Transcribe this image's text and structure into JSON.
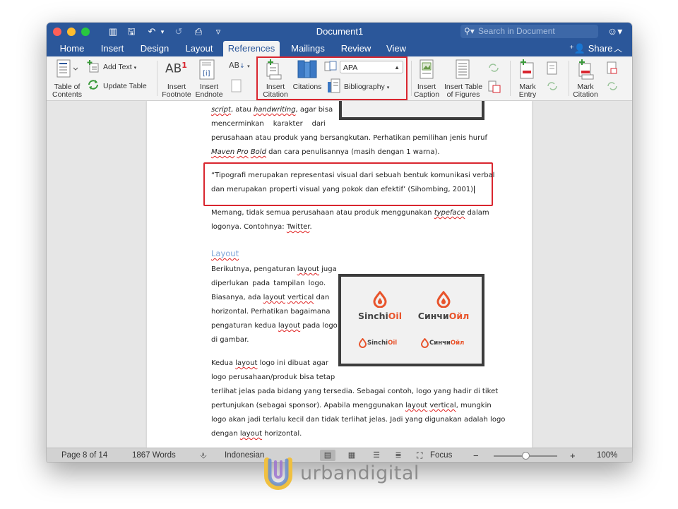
{
  "window": {
    "title": "Document1",
    "search_placeholder": "Search in Document",
    "qat": {
      "layout_icon": "▥",
      "save_icon": "🖫",
      "undo_icon": "↶",
      "undo_menu": "▾",
      "redo_icon": "↺",
      "print_icon": "⎙",
      "customize_icon": "▿"
    },
    "user_icon": "☺▾"
  },
  "tabs": [
    {
      "label": "Home"
    },
    {
      "label": "Insert"
    },
    {
      "label": "Design"
    },
    {
      "label": "Layout"
    },
    {
      "label": "References",
      "active": true
    },
    {
      "label": "Mailings"
    },
    {
      "label": "Review"
    },
    {
      "label": "View"
    }
  ],
  "share_label": "Share",
  "share_icon": "⁺👤",
  "collapse_icon": "︿",
  "ribbon": {
    "toc": {
      "line1": "Table of",
      "line2": "Contents"
    },
    "add_text": "Add Text",
    "update_table": "Update Table",
    "insert_footnote": {
      "line1": "Insert",
      "line2": "Footnote"
    },
    "insert_endnote": {
      "line1": "Insert",
      "line2": "Endnote"
    },
    "insert_citation": {
      "line1": "Insert",
      "line2": "Citation"
    },
    "citations": "Citations",
    "style_select": "APA",
    "bibliography": "Bibliography",
    "insert_caption": {
      "line1": "Insert",
      "line2": "Caption"
    },
    "insert_table_of_figures": {
      "line1": "Insert Table",
      "line2": "of Figures"
    },
    "mark_entry": {
      "line1": "Mark",
      "line2": "Entry"
    },
    "mark_citation": {
      "line1": "Mark",
      "line2": "Citation"
    },
    "footnote_icon_text": "AB",
    "footnote_icon_sup": "1",
    "endnote_icon_text": "[i]",
    "next_footnote_icon": "AB"
  },
  "document": {
    "line1": {
      "p1": "script",
      "p2": ", atau ",
      "p3": "handwriting",
      "p4": ", agar bisa"
    },
    "line2": "mencerminkan karakter dari",
    "line3": "perusahaan atau produk yang bersangkutan. Perhatikan pemilihan jenis huruf",
    "line4": {
      "p1": "Maven",
      "p2": " ",
      "p3": "Pro",
      "p4": " ",
      "p5": "Bold",
      "p6": " dan cara penulisannya (masih dengan 1 warna)."
    },
    "quote_line1": "“Tipografi merupakan representasi visual dari sebuah bentuk komunikasi verbal",
    "quote_line2": "dan merupakan properti visual yang pokok dan efektif’ (Sihombing, 2001)",
    "p2_line1": {
      "p1": "Memang, tidak semua perusahaan atau produk menggunakan ",
      "p2": "typeface",
      "p3": " dalam"
    },
    "p2_line2": {
      "p1": "logonya. Contohnya: ",
      "p2": "Twitter",
      "p3": "."
    },
    "heading": "Layout",
    "p3_line1": {
      "p1": "Berikutnya, pengaturan ",
      "p2": "layout",
      "p3": " juga"
    },
    "p3_line2": "diperlukan pada tampilan logo.",
    "p3_line3": {
      "p1": "Biasanya, ada ",
      "p2": "layout",
      "p3": " ",
      "p4": "vertical",
      "p5": " dan"
    },
    "p3_line4": "horizontal. Perhatikan bagaimana",
    "p3_line5": {
      "p1": "pengaturan kedua ",
      "p2": "layout",
      "p3": " pada logo"
    },
    "p3_line6": "di gambar.",
    "p4_line1": {
      "p1": "Kedua ",
      "p2": "layout",
      "p3": " logo ini dibuat agar"
    },
    "p4_line2": "logo perusahaan/produk bisa tetap",
    "p4_line3": "terlihat jelas pada bidang yang tersedia. Sebagai contoh, logo yang hadir di tiket",
    "p4_line4": {
      "p1": "pertunjukan (sebagai sponsor). Apabila menggunakan ",
      "p2": "layout",
      "p3": " ",
      "p4": "vertical",
      "p5": ", mungkin"
    },
    "p4_line5": "logo akan jadi terlalu kecil dan tidak terlihat jelas. Jadi yang digunakan adalah logo",
    "p4_line6": {
      "p1": "dengan ",
      "p2": "layout",
      "p3": " horizontal."
    },
    "logo_image": {
      "latin_a": "Sinchi",
      "latin_b": "Oil",
      "cyrillic_a": "Синчи",
      "cyrillic_b": "Ойл"
    }
  },
  "status": {
    "page": "Page 8 of 14",
    "words": "1867 Words",
    "proofing_icon": "⎀",
    "language": "Indonesian",
    "view_icons": [
      "▤",
      "▦",
      "☰",
      "≣"
    ],
    "focus_icon": "⛶",
    "focus": "Focus",
    "zoom_minus": "−",
    "zoom_plus": "+",
    "zoom_value": 0.5,
    "zoom": "100%"
  },
  "watermark": "urbandigital",
  "colors": {
    "brand": "#2b579a",
    "highlight": "#d9262f",
    "logo_orange": "#e8542c"
  }
}
